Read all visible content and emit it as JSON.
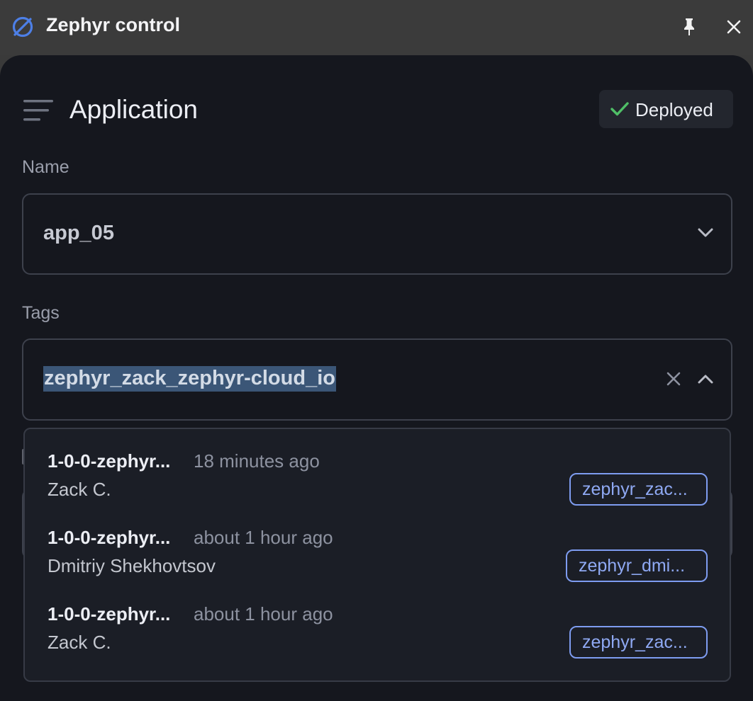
{
  "window": {
    "title": "Zephyr control",
    "logo_icon": "zephyr-logo-icon",
    "pin_icon": "pin-icon",
    "close_icon": "close-icon"
  },
  "header": {
    "menu_icon": "menu-icon",
    "title": "Application",
    "status": {
      "label": "Deployed",
      "icon": "check-icon",
      "color": "#4fbf67"
    }
  },
  "name_field": {
    "label": "Name",
    "value": "app_05"
  },
  "tags_field": {
    "label": "Tags",
    "value": "zephyr_zack_zephyr-cloud_io"
  },
  "versions": [
    {
      "version": "1-0-0-zephyr...",
      "time": "18 minutes ago",
      "author": "Zack C.",
      "tag": "zephyr_zac..."
    },
    {
      "version": "1-0-0-zephyr...",
      "time": "about 1 hour ago",
      "author": "Dmitriy Shekhovtsov",
      "tag": "zephyr_dmi..."
    },
    {
      "version": "1-0-0-zephyr...",
      "time": "about 1 hour ago",
      "author": "Zack C.",
      "tag": "zephyr_zac..."
    }
  ],
  "colors": {
    "background": "#15171e",
    "titlebar": "#3b3b3b",
    "accent_tag": "#7e9cf0",
    "selection": "#3b5677"
  }
}
